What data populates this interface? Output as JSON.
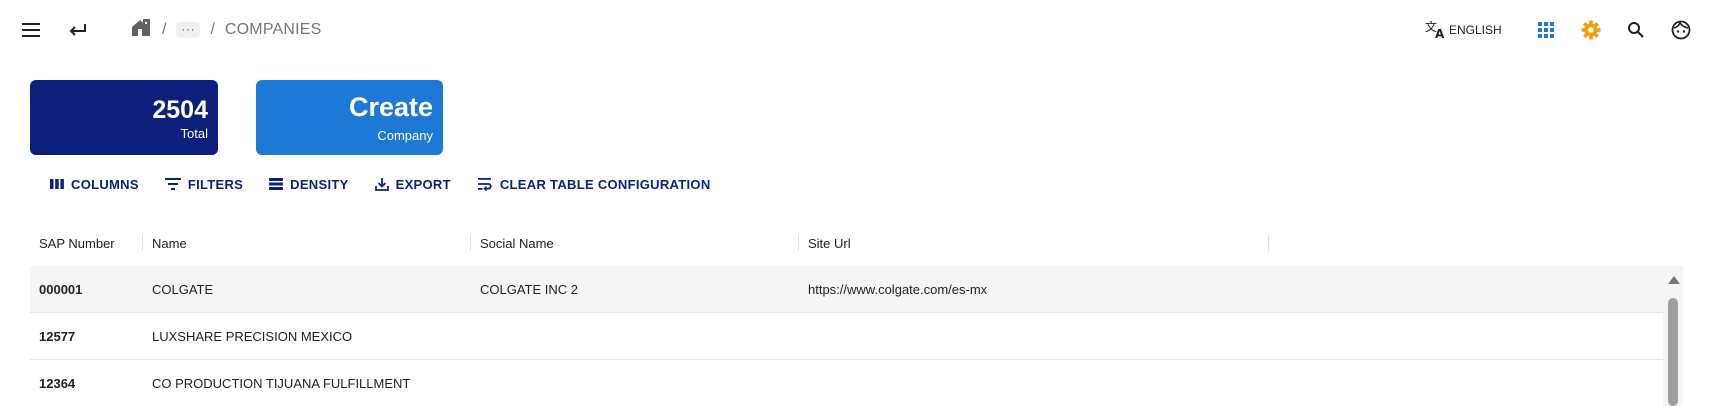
{
  "topbar": {
    "menu_icon": "menu-icon",
    "back_icon": "back-arrow-icon",
    "breadcrumb": {
      "home_icon": "home-icon",
      "sep1": "/",
      "more": "···",
      "sep2": "/",
      "current": "COMPANIES"
    },
    "language": {
      "icon": "translate-icon",
      "label": "ENGLISH"
    },
    "apps_icon": "apps-grid-icon",
    "settings_icon": "gear-icon",
    "search_icon": "search-icon",
    "profile_icon": "face-icon"
  },
  "cards": {
    "total": {
      "value": "2504",
      "label": "Total"
    },
    "create": {
      "title": "Create",
      "subtitle": "Company"
    }
  },
  "toolbar": {
    "columns": "COLUMNS",
    "filters": "FILTERS",
    "density": "DENSITY",
    "export": "EXPORT",
    "clear": "CLEAR TABLE CONFIGURATION"
  },
  "table": {
    "columns": [
      "SAP Number",
      "Name",
      "Social Name",
      "Site Url"
    ],
    "rows": [
      {
        "sap": "000001",
        "name": "COLGATE",
        "social": "COLGATE INC 2",
        "url": "https://www.colgate.com/es-mx"
      },
      {
        "sap": "12577",
        "name": "LUXSHARE PRECISION MEXICO",
        "social": "",
        "url": ""
      },
      {
        "sap": "12364",
        "name": "CO PRODUCTION TIJUANA FULFILLMENT",
        "social": "",
        "url": ""
      }
    ]
  },
  "colors": {
    "total_card": "#0d1f7a",
    "create_card": "#1e78d6",
    "toolbar_text": "#0d2080",
    "apps_icon": "#1e78d6",
    "settings_icon": "#f59e0b"
  }
}
